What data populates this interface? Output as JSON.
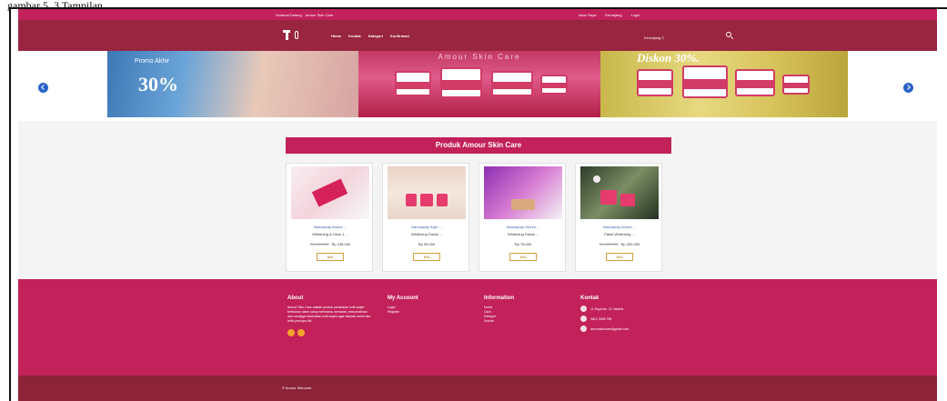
{
  "caption": "gambar 5. 3 Tampilan ...",
  "topbar": {
    "welcome": "Selamat Datang",
    "brand": "Amour Skin Care",
    "links": [
      "Akun Saya",
      "Keranjang",
      "Login"
    ]
  },
  "nav": {
    "links": [
      "Home",
      "Kontak",
      "Kategori",
      "Konfirmasi"
    ],
    "cart_label": "Keranjang 0"
  },
  "slider": {
    "slide1_small": "Promo Akhir",
    "slide1_big": "30%",
    "slide2_head": "Amour Skin Care",
    "slide3_head": "Diskon 30%."
  },
  "section": {
    "title": "Produk Amour Skin Care"
  },
  "products": [
    {
      "name1": "Nanospray Amour ...",
      "name2": "Whitening & Glow 1 ...",
      "old_price": "Rp 150.000",
      "price": "Rp 135.000",
      "button": "Beli"
    },
    {
      "name1": "Nanospray Kojic ...",
      "name2": "Whitening Facial ...",
      "old_price": "",
      "price": "Rp 95.000",
      "button": "Beli"
    },
    {
      "name1": "Nanospray Serum ...",
      "name2": "Whitening Facial ...",
      "old_price": "",
      "price": "Rp 75.000",
      "button": "Beli"
    },
    {
      "name1": "Nanospray Amour ...",
      "name2": "Paket Whitening ...",
      "old_price": "Rp 225.000",
      "price": "Rp 200.000",
      "button": "Beli"
    }
  ],
  "footer": {
    "about_title": "About",
    "about_text": "Amour Skin Care adalah produk perawatan kulit wajah berbahan alami yang membantu merawat, mencerahkan dan menjaga kesehatan kulit wajah agar tampak sehat dan lebih percaya diri.",
    "account_title": "My Account",
    "account_links": [
      "Login",
      "Register"
    ],
    "info_title": "Information",
    "info_links": [
      "Home",
      "Cara",
      "Kategori",
      "Kontak"
    ],
    "kontak_title": "Kontak",
    "kontak_items": [
      "Jl. Raya No. 12 Jakarta",
      "0812 3456 789",
      "amourskincare@gmail.com"
    ]
  },
  "copyright": "© Amour Skincare",
  "colors": {
    "topbar": "#c2215a",
    "navbar": "#992540",
    "footer": "#c2215a",
    "bottombar": "#8c2339",
    "slider_arrow": "#2a63c7"
  }
}
